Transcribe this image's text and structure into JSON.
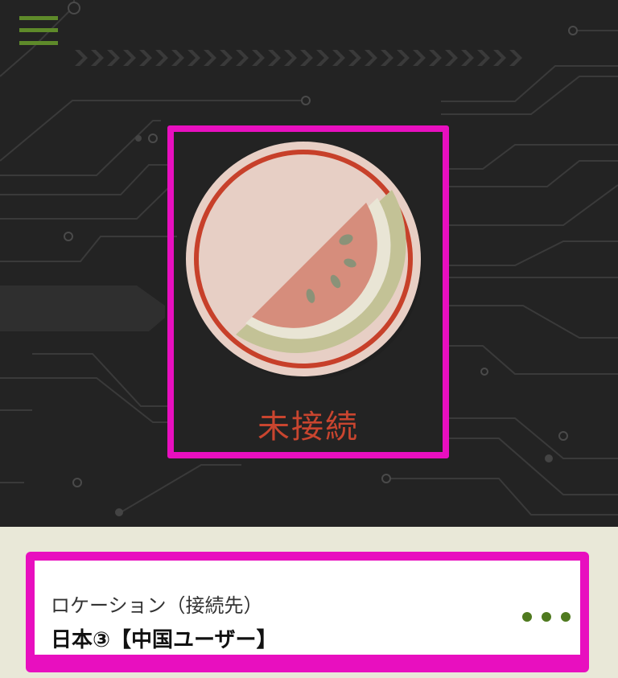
{
  "app": {
    "status_text": "未接続"
  },
  "location": {
    "label": "ロケーション（接続先）",
    "value": "日本③【中国ユーザー】"
  },
  "icons": {
    "menu": "hamburger-menu-icon",
    "power": "watermelon-icon",
    "more": "more-dots-icon"
  },
  "colors": {
    "background_dark": "#232323",
    "accent_green": "#5e8a2a",
    "status_red": "#c9452f",
    "highlight_magenta": "#e80fbf",
    "bottom_panel": "#e9e8d8"
  }
}
